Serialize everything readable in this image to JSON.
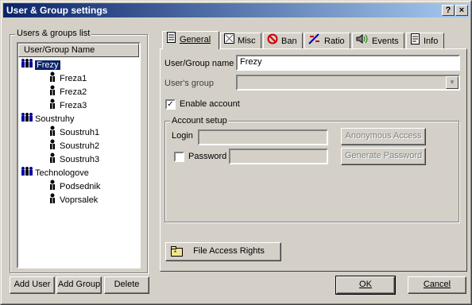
{
  "window": {
    "title": "User & Group settings",
    "help_label": "?",
    "close_label": "×"
  },
  "left_panel": {
    "group_label": "Users & groups list",
    "column_header": "User/Group Name",
    "tree": [
      {
        "name": "Frezy",
        "type": "group"
      },
      {
        "name": "Freza1",
        "type": "user"
      },
      {
        "name": "Freza2",
        "type": "user"
      },
      {
        "name": "Freza3",
        "type": "user"
      },
      {
        "name": "Soustruhy",
        "type": "group"
      },
      {
        "name": "Soustruh1",
        "type": "user"
      },
      {
        "name": "Soustruh2",
        "type": "user"
      },
      {
        "name": "Soustruh3",
        "type": "user"
      },
      {
        "name": "Technologove",
        "type": "group"
      },
      {
        "name": "Podsednik",
        "type": "user"
      },
      {
        "name": "Voprsalek",
        "type": "user"
      }
    ],
    "buttons": {
      "add_user": "Add User",
      "add_group": "Add Group",
      "delete": "Delete"
    }
  },
  "tabs": [
    {
      "label": "General",
      "icon": "document-icon"
    },
    {
      "label": "Misc",
      "icon": "misc-icon"
    },
    {
      "label": "Ban",
      "icon": "ban-icon"
    },
    {
      "label": "Ratio",
      "icon": "ratio-icon"
    },
    {
      "label": "Events",
      "icon": "speaker-icon"
    },
    {
      "label": "Info",
      "icon": "info-icon"
    }
  ],
  "general": {
    "name_label": "User/Group name",
    "name_value": "Frezy",
    "group_label": "User's group",
    "group_value": "",
    "enable_label": "Enable account",
    "enable_checked": "✓",
    "account_setup_label": "Account setup",
    "login_label": "Login",
    "login_value": "",
    "password_label": "Password",
    "password_value": "",
    "password_checked": "",
    "anonymous_access_label": "Anonymous Access",
    "generate_password_label": "Generate Password",
    "file_access_label": "File Access Rights"
  },
  "footer": {
    "ok_label": "OK",
    "cancel_label": "Cancel"
  },
  "colors": {
    "title_start": "#0a246a",
    "title_end": "#a6caf0",
    "selection": "#0a246a",
    "face": "#d4d0c8"
  }
}
